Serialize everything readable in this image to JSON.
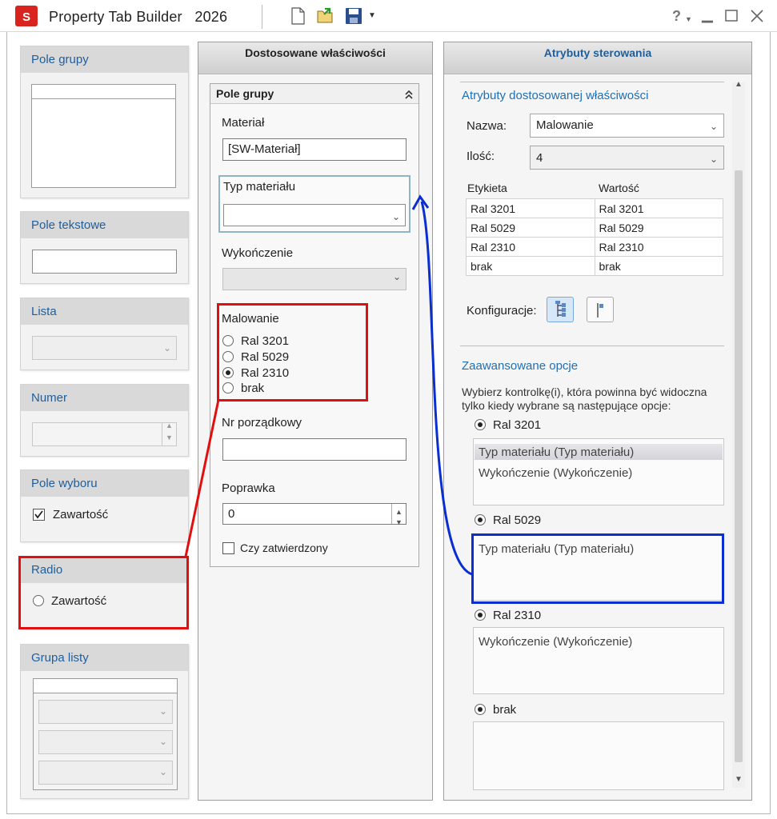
{
  "window": {
    "title": "Property Tab Builder",
    "year": "2026",
    "help_label": "?"
  },
  "palette": {
    "group_box": "Pole grupy",
    "text_field": "Pole tekstowe",
    "list": "Lista",
    "number": "Numer",
    "checkbox": "Pole wyboru",
    "checkbox_content": "Zawartość",
    "radio": "Radio",
    "radio_content": "Zawartość",
    "list_group": "Grupa listy"
  },
  "center": {
    "header": "Dostosowane właściwości",
    "group_title": "Pole grupy",
    "material_label": "Materiał",
    "material_value": "[SW-Materiał]",
    "material_type_label": "Typ materiału",
    "finish_label": "Wykończenie",
    "paint_label": "Malowanie",
    "paint_options": [
      "Ral 3201",
      "Ral 5029",
      "Ral 2310",
      "brak"
    ],
    "paint_selected": 2,
    "serial_label": "Nr porządkowy",
    "revision_label": "Poprawka",
    "revision_value": "0",
    "approved_label": "Czy zatwierdzony"
  },
  "right": {
    "header": "Atrybuty sterowania",
    "section_title": "Atrybuty dostosowanej właściwości",
    "name_label": "Nazwa:",
    "name_value": "Malowanie",
    "qty_label": "Ilość:",
    "qty_value": "4",
    "table_headers": [
      "Etykieta",
      "Wartość"
    ],
    "table_rows": [
      [
        "Ral 3201",
        "Ral 3201"
      ],
      [
        "Ral 5029",
        "Ral 5029"
      ],
      [
        "Ral 2310",
        "Ral 2310"
      ],
      [
        "brak",
        "brak"
      ]
    ],
    "config_label": "Konfiguracje:",
    "advanced_title": "Zaawansowane opcje",
    "advanced_desc_1": "Wybierz kontrolkę(i), która powinna być widoczna",
    "advanced_desc_2": "tylko kiedy wybrane są następujące opcje:",
    "options": [
      {
        "label": "Ral 3201",
        "items": [
          "Typ materiału (Typ materiału)",
          "Wykończenie (Wykończenie)"
        ]
      },
      {
        "label": "Ral 5029",
        "items": [
          "Typ materiału (Typ materiału)"
        ]
      },
      {
        "label": "Ral 2310",
        "items": [
          "Wykończenie (Wykończenie)"
        ]
      },
      {
        "label": "brak",
        "items": []
      }
    ]
  },
  "colors": {
    "accent_blue": "#1f6fb5",
    "annotation_red": "#e01010",
    "annotation_blue": "#0a2ed0"
  }
}
